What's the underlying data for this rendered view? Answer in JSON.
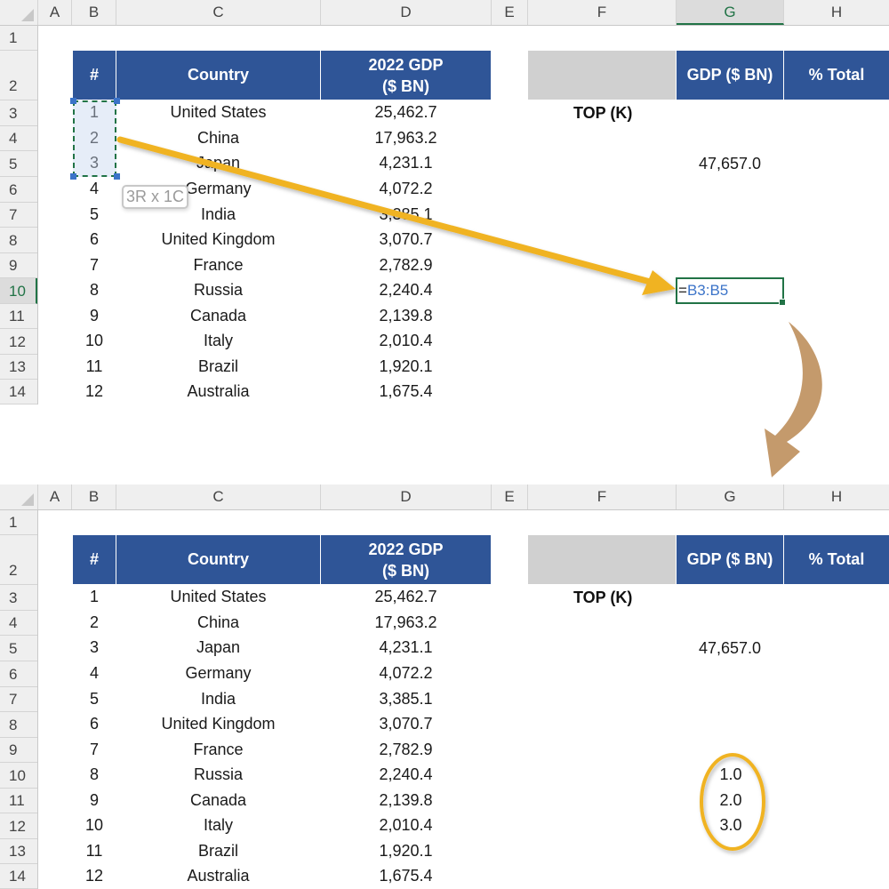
{
  "columns": [
    "A",
    "B",
    "C",
    "D",
    "E",
    "F",
    "G",
    "H"
  ],
  "rows": [
    "1",
    "2",
    "3",
    "4",
    "5",
    "6",
    "7",
    "8",
    "9",
    "10",
    "11",
    "12",
    "13",
    "14"
  ],
  "table": {
    "headers": {
      "rank": "#",
      "country": "Country",
      "gdp_line1": "2022 GDP",
      "gdp_line2": "($ BN)"
    },
    "records": [
      {
        "rank": "1",
        "country": "United States",
        "gdp": "25,462.7"
      },
      {
        "rank": "2",
        "country": "China",
        "gdp": "17,963.2"
      },
      {
        "rank": "3",
        "country": "Japan",
        "gdp": "4,231.1"
      },
      {
        "rank": "4",
        "country": "Germany",
        "gdp": "4,072.2"
      },
      {
        "rank": "5",
        "country": "India",
        "gdp": "3,385.1"
      },
      {
        "rank": "6",
        "country": "United Kingdom",
        "gdp": "3,070.7"
      },
      {
        "rank": "7",
        "country": "France",
        "gdp": "2,782.9"
      },
      {
        "rank": "8",
        "country": "Russia",
        "gdp": "2,240.4"
      },
      {
        "rank": "9",
        "country": "Canada",
        "gdp": "2,139.8"
      },
      {
        "rank": "10",
        "country": "Italy",
        "gdp": "2,010.4"
      },
      {
        "rank": "11",
        "country": "Brazil",
        "gdp": "1,920.1"
      },
      {
        "rank": "12",
        "country": "Australia",
        "gdp": "1,675.4"
      }
    ]
  },
  "summary": {
    "gdp_header": "GDP ($ BN)",
    "pct_header": "% Total",
    "topk_label": "TOP (K)",
    "total_value": "47,657.0"
  },
  "top_sheet": {
    "selected_column": "G",
    "selected_row": "10",
    "selection_tooltip": "3R x 1C",
    "formula_eq": "=",
    "formula_ref": "B3:B5"
  },
  "bottom_sheet": {
    "spill_results": [
      "1.0",
      "2.0",
      "3.0"
    ]
  },
  "colors": {
    "header_blue": "#2f5597",
    "excel_green": "#217346",
    "arrow_yellow": "#f0b323",
    "arrow_tan": "#c49a6c"
  }
}
